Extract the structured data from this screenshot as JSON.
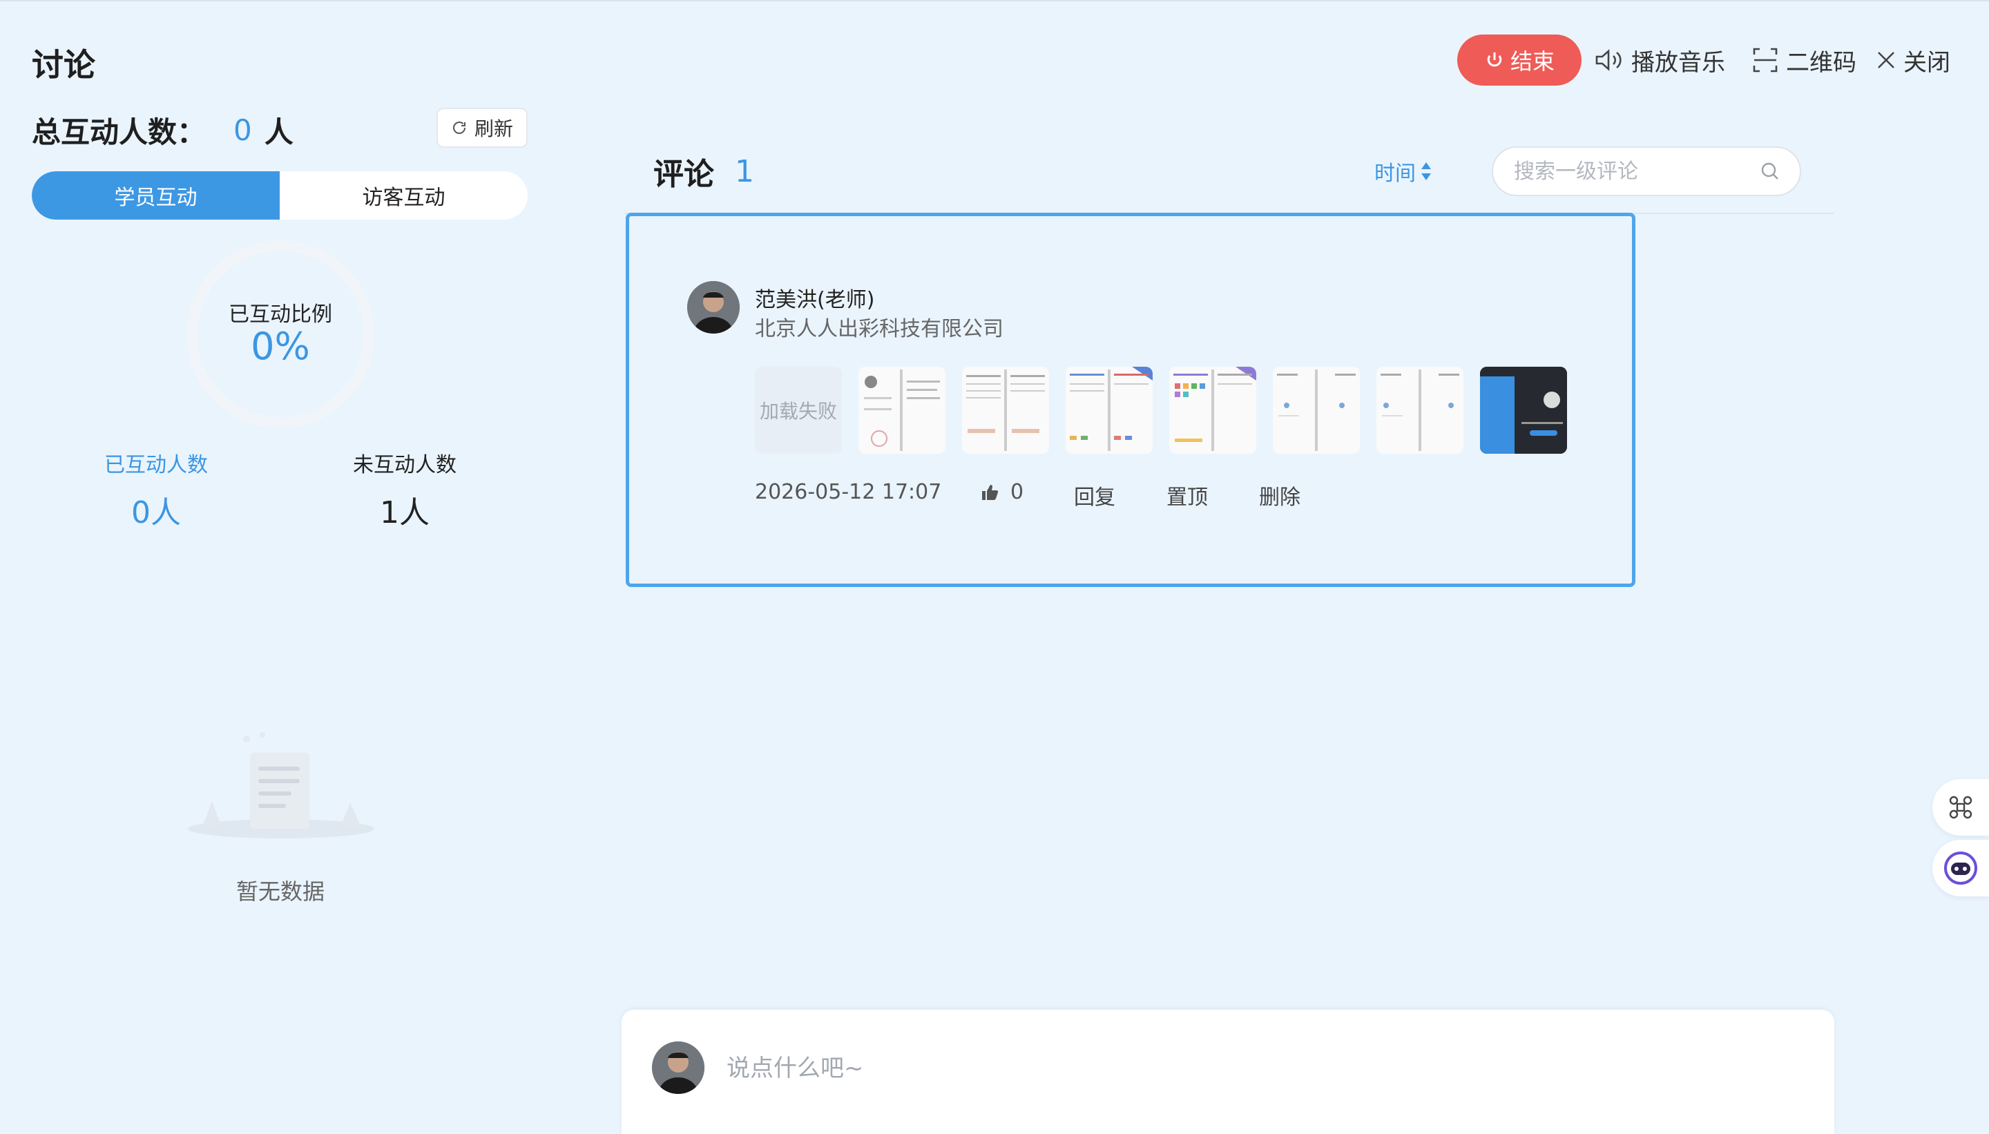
{
  "page": {
    "title": "讨论"
  },
  "summary": {
    "total_label": "总互动人数：",
    "total_value": "0",
    "total_unit": "人",
    "refresh_label": "刷新"
  },
  "tabs": [
    {
      "label": "学员互动",
      "active": true
    },
    {
      "label": "访客互动",
      "active": false
    }
  ],
  "ratio": {
    "label": "已互动比例",
    "value": "0%"
  },
  "stats": {
    "interacted_label": "已互动人数",
    "interacted_value": "0人",
    "not_interacted_label": "未互动人数",
    "not_interacted_value": "1人"
  },
  "empty": {
    "text": "暂无数据"
  },
  "toolbar": {
    "end_label": "结束",
    "music_label": "播放音乐",
    "qr_label": "二维码",
    "close_label": "关闭"
  },
  "comments": {
    "title": "评论",
    "count": "1",
    "sort_label": "时间",
    "search_placeholder": "搜索一级评论",
    "items": [
      {
        "author": "范美洪(老师)",
        "company": "北京人人出彩科技有限公司",
        "failed_image_text": "加载失败",
        "time": "2026-05-12 17:07",
        "likes": "0",
        "reply_label": "回复",
        "pin_label": "置顶",
        "delete_label": "删除"
      }
    ]
  },
  "composer": {
    "placeholder": "说点什么吧~"
  },
  "colors": {
    "accent": "#3b96e3",
    "danger": "#ef5b57",
    "background": "#eaf4fd"
  }
}
